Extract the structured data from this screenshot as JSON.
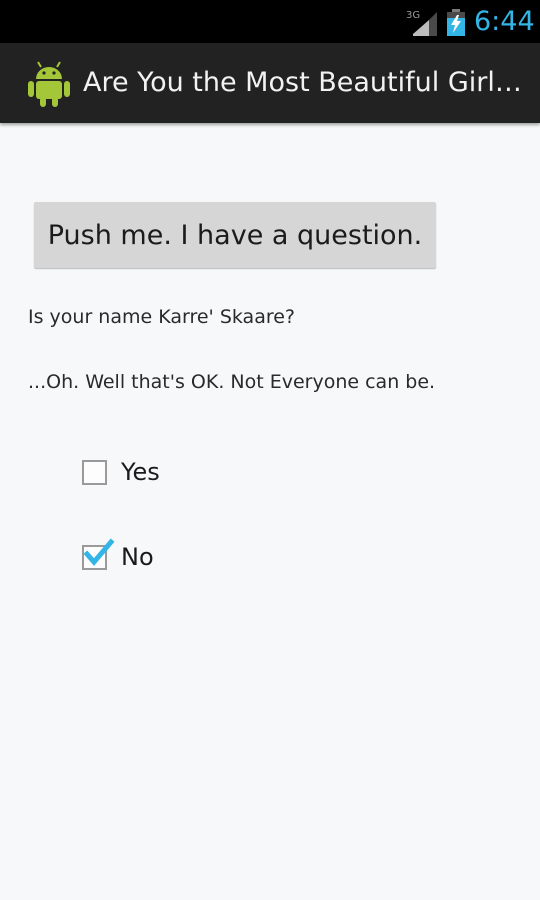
{
  "status_bar": {
    "network": "3G",
    "time": "6:44"
  },
  "action_bar": {
    "title": "Are You the Most Beautiful Girl…",
    "icon": "android-robot-icon"
  },
  "main": {
    "button_label": "Push me. I have a question.",
    "question": "Is your name Karre' Skaare?",
    "response": "...Oh. Well that's OK. Not Everyone can be.",
    "options": [
      {
        "label": "Yes",
        "checked": false
      },
      {
        "label": "No",
        "checked": true
      }
    ]
  },
  "colors": {
    "accent": "#33b5e5",
    "android_green": "#a4c639",
    "background": "#f7f8f9"
  }
}
